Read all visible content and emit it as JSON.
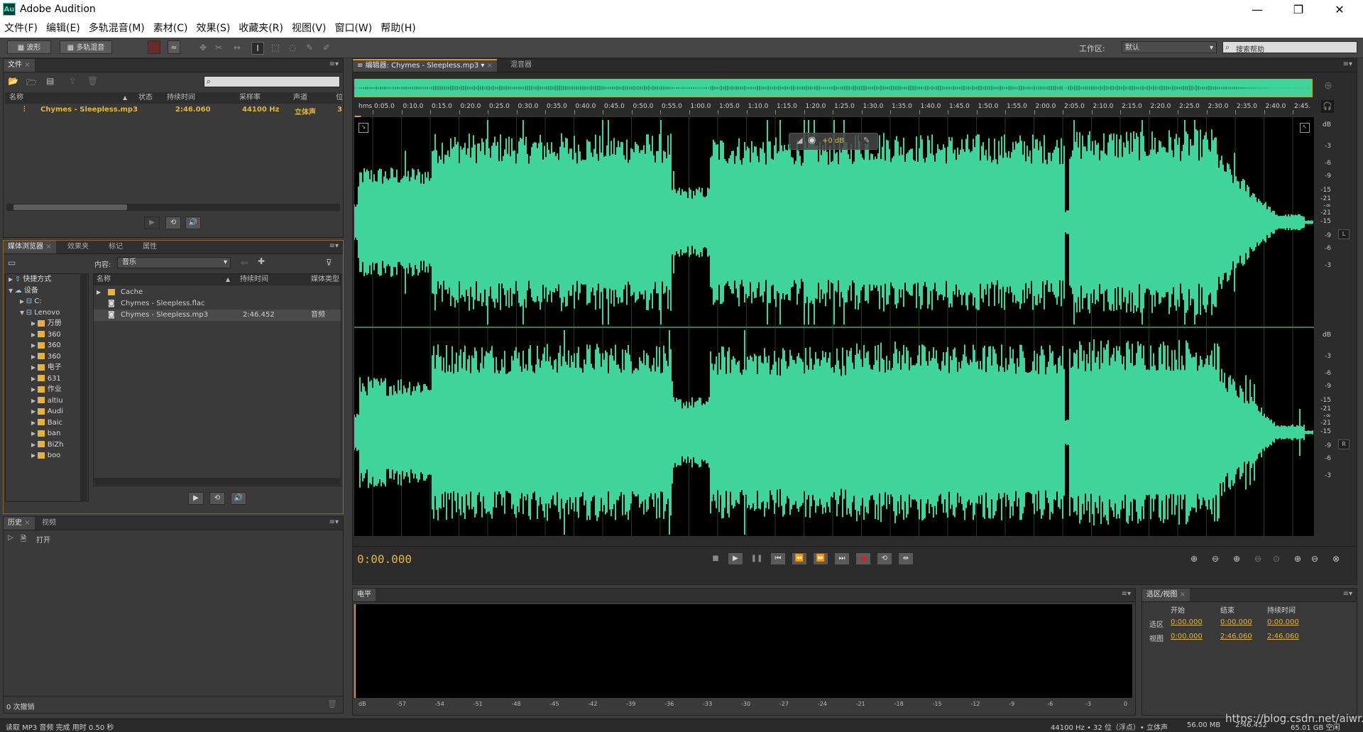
{
  "app": {
    "title": "Adobe Audition",
    "logo": "Au"
  },
  "window_controls": {
    "minimize": "—",
    "restore": "❐",
    "close": "✕"
  },
  "menu": [
    "文件(F)",
    "编辑(E)",
    "多轨混音(M)",
    "素材(C)",
    "效果(S)",
    "收藏夹(R)",
    "视图(V)",
    "窗口(W)",
    "帮助(H)"
  ],
  "toolbar": {
    "waveform_label": "波形",
    "multitrack_label": "多轨混音",
    "workspace_label": "工作区:",
    "workspace_value": "默认",
    "search_placeholder": "搜索帮助"
  },
  "files_panel": {
    "tab": "文件",
    "columns": [
      "名称",
      "状态",
      "持续时间",
      "采样率",
      "声道",
      "位"
    ],
    "rows": [
      {
        "name": "Chymes - Sleepless.mp3",
        "status": "",
        "duration": "2:46.060",
        "sample_rate": "44100 Hz",
        "channels": "立体声",
        "bits": "3"
      }
    ]
  },
  "media_browser": {
    "tabs": [
      "媒体浏览器",
      "效果夹",
      "标记",
      "属性"
    ],
    "content_label": "内容:",
    "content_value": "音乐",
    "tree": [
      {
        "label": "快捷方式",
        "level": 0,
        "expanded": false,
        "kind": "shortcut"
      },
      {
        "label": "设备",
        "level": 0,
        "expanded": true,
        "kind": "device"
      },
      {
        "label": "C:",
        "level": 1,
        "expanded": false,
        "kind": "drive"
      },
      {
        "label": "Lenovo",
        "level": 1,
        "expanded": true,
        "kind": "drive"
      },
      {
        "label": "万册",
        "level": 2,
        "expanded": false,
        "kind": "folder"
      },
      {
        "label": "360",
        "level": 2,
        "expanded": false,
        "kind": "folder"
      },
      {
        "label": "360",
        "level": 2,
        "expanded": false,
        "kind": "folder"
      },
      {
        "label": "360",
        "level": 2,
        "expanded": false,
        "kind": "folder"
      },
      {
        "label": "电子",
        "level": 2,
        "expanded": false,
        "kind": "folder"
      },
      {
        "label": "631",
        "level": 2,
        "expanded": false,
        "kind": "folder"
      },
      {
        "label": "作业",
        "level": 2,
        "expanded": false,
        "kind": "folder"
      },
      {
        "label": "altiu",
        "level": 2,
        "expanded": false,
        "kind": "folder"
      },
      {
        "label": "Audi",
        "level": 2,
        "expanded": false,
        "kind": "folder"
      },
      {
        "label": "Baic",
        "level": 2,
        "expanded": false,
        "kind": "folder"
      },
      {
        "label": "ban",
        "level": 2,
        "expanded": false,
        "kind": "folder"
      },
      {
        "label": "BiZh",
        "level": 2,
        "expanded": false,
        "kind": "folder"
      },
      {
        "label": "boo",
        "level": 2,
        "expanded": false,
        "kind": "folder"
      }
    ],
    "list_columns": [
      "名称",
      "持续时间",
      "媒体类型"
    ],
    "list_rows": [
      {
        "name": "Cache",
        "duration": "",
        "type": "",
        "kind": "folder"
      },
      {
        "name": "Chymes - Sleepless.flac",
        "duration": "",
        "type": "",
        "kind": "audio"
      },
      {
        "name": "Chymes - Sleepless.mp3",
        "duration": "2:46.452",
        "type": "音频",
        "kind": "audio"
      }
    ]
  },
  "history_panel": {
    "tabs": [
      "历史",
      "视频"
    ],
    "items": [
      "打开"
    ],
    "undo_count": "0 次撤销"
  },
  "editor": {
    "tab": "编辑器: Chymes - Sleepless.mp3",
    "mixer_tab": "混音器",
    "ruler_unit": "hms",
    "ruler_ticks": [
      "0:05.0",
      "0:10.0",
      "0:15.0",
      "0:20.0",
      "0:25.0",
      "0:30.0",
      "0:35.0",
      "0:40.0",
      "0:45.0",
      "0:50.0",
      "0:55.0",
      "1:00.0",
      "1:05.0",
      "1:10.0",
      "1:15.0",
      "1:20.0",
      "1:25.0",
      "1:30.0",
      "1:35.0",
      "1:40.0",
      "1:45.0",
      "1:50.0",
      "1:55.0",
      "2:00.0",
      "2:05.0",
      "2:10.0",
      "2:15.0",
      "2:20.0",
      "2:25.0",
      "2:30.0",
      "2:35.0",
      "2:40.0",
      "2:45."
    ],
    "hud_gain": "+0 dB",
    "db_scale": [
      "dB",
      "-3",
      "-6",
      "-9",
      "-15",
      "-21",
      "-∞",
      "-21",
      "-15",
      "-9",
      "-6",
      "-3"
    ],
    "channel_left": "L",
    "channel_right": "R",
    "current_time": "0:00.000",
    "waveform_color": "#3fd49b",
    "duration_seconds": 166.06
  },
  "level_meter": {
    "tab": "电平",
    "scale": [
      "dB",
      "-57",
      "-54",
      "-51",
      "-48",
      "-45",
      "-42",
      "-39",
      "-36",
      "-33",
      "-30",
      "-27",
      "-24",
      "-21",
      "-18",
      "-15",
      "-12",
      "-9",
      "-6",
      "-3",
      "0"
    ]
  },
  "selection_view": {
    "tab": "选区/视图",
    "col_start": "开始",
    "col_end": "结束",
    "col_duration": "持续时间",
    "selection_label": "选区",
    "view_label": "视图",
    "selection": {
      "start": "0:00.000",
      "end": "0:00.000",
      "duration": "0:00.000"
    },
    "view": {
      "start": "0:00.000",
      "end": "2:46.060",
      "duration": "2:46.060"
    }
  },
  "status_bar": {
    "message": "读取 MP3 音频 完成 用时 0.50 秒",
    "sample_rate": "44100 Hz • 32 位（浮点）• 立体声",
    "size": "56.00 MB",
    "duration": "2:46.452",
    "free_space": "65.01 GB 空闲",
    "watermark": "https://blog.csdn.net/aiwr..."
  }
}
